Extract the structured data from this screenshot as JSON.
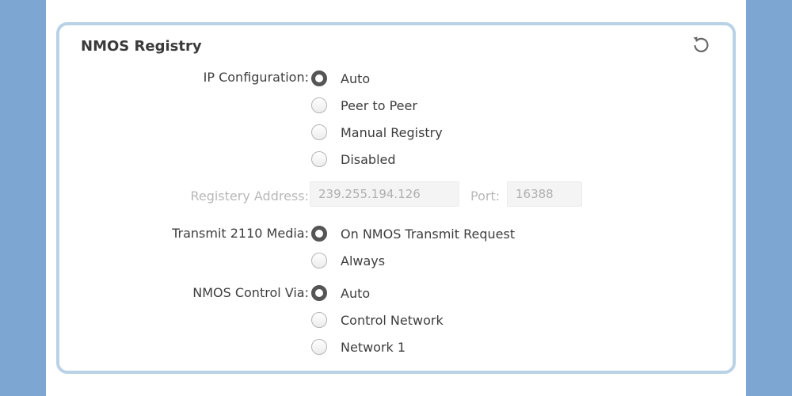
{
  "panel": {
    "title": "NMOS Registry",
    "reset_icon": "reset-icon"
  },
  "ip_configuration": {
    "label": "IP Configuration:",
    "options": [
      "Auto",
      "Peer to Peer",
      "Manual Registry",
      "Disabled"
    ],
    "selected": "Auto"
  },
  "registry": {
    "address_label": "Registery Address:",
    "address_value": "239.255.194.126",
    "port_label": "Port:",
    "port_value": "16388"
  },
  "transmit_media": {
    "label": "Transmit 2110 Media:",
    "options": [
      "On NMOS Transmit Request",
      "Always"
    ],
    "selected": "On NMOS Transmit Request"
  },
  "control_via": {
    "label": "NMOS Control Via:",
    "options": [
      "Auto",
      "Control Network",
      "Network 1"
    ],
    "selected": "Auto"
  },
  "colors": {
    "background": "#7da6d2",
    "panel_border": "#b9d2e6",
    "radio_checked": "#555555"
  }
}
